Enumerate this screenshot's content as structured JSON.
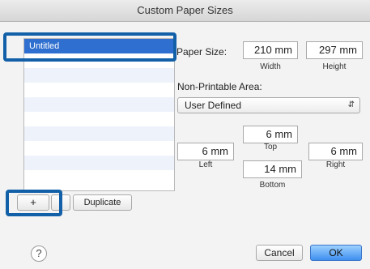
{
  "window": {
    "title": "Custom Paper Sizes"
  },
  "list": {
    "items": [
      "Untitled",
      "",
      "",
      "",
      "",
      "",
      "",
      "",
      "",
      ""
    ]
  },
  "paper_size": {
    "label": "Paper Size:",
    "width_value": "210  mm",
    "width_label": "Width",
    "height_value": "297  mm",
    "height_label": "Height"
  },
  "non_printable": {
    "label": "Non-Printable Area:",
    "selected_option": "User Defined",
    "top_value": "6  mm",
    "top_label": "Top",
    "left_value": "6  mm",
    "left_label": "Left",
    "right_value": "6  mm",
    "right_label": "Right",
    "bottom_value": "14  mm",
    "bottom_label": "Bottom"
  },
  "buttons": {
    "add": "+",
    "remove": "",
    "duplicate": "Duplicate",
    "help": "?",
    "cancel": "Cancel",
    "ok": "OK"
  },
  "colors": {
    "highlight": "#1260a8",
    "selection": "#2f6fcf",
    "default_button": "#3f8ff0"
  }
}
